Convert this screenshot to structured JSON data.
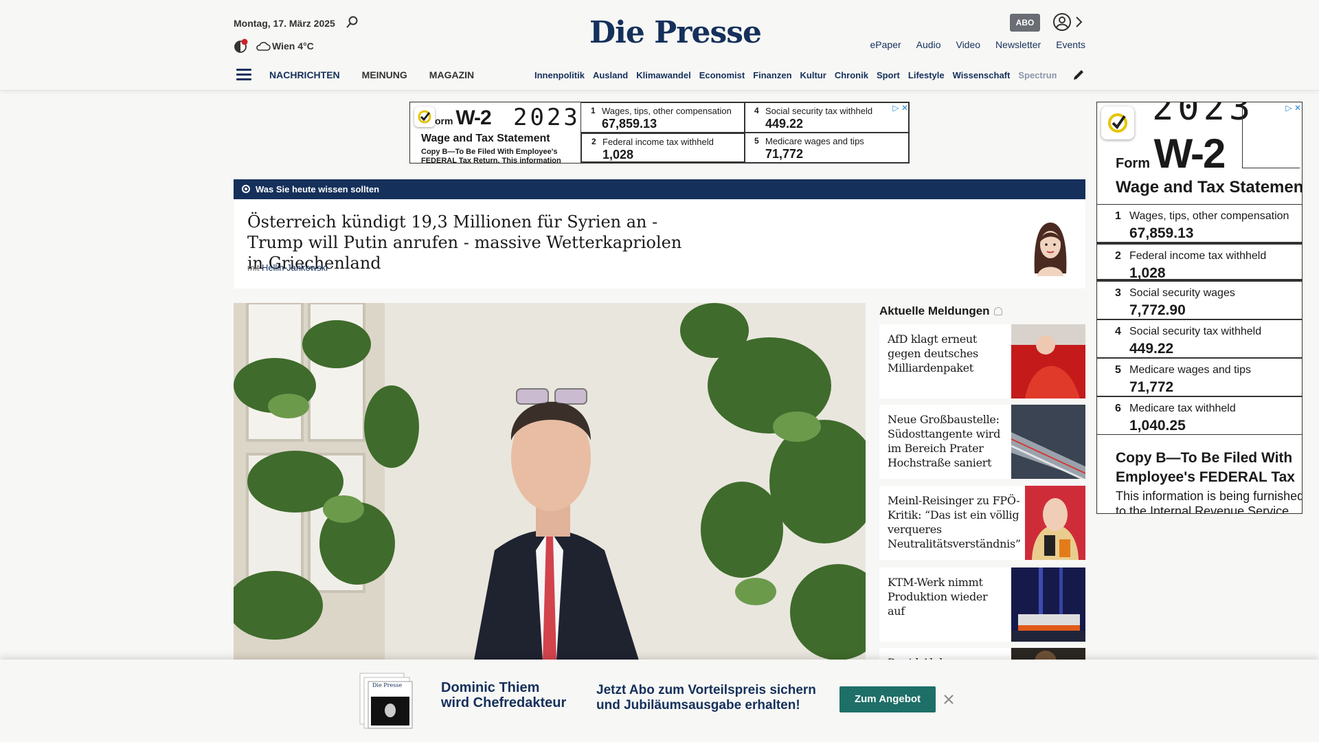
{
  "header": {
    "date": "Montag, 17. März 2025",
    "weather": "Wien 4°C",
    "logo": "Die Presse",
    "abo_label": "ABO",
    "top_links": [
      "ePaper",
      "Audio",
      "Video",
      "Newsletter",
      "Events"
    ],
    "main_nav": [
      "NACHRICHTEN",
      "MEINUNG",
      "MAGAZIN"
    ],
    "sub_nav": [
      "Innenpolitik",
      "Ausland",
      "Klimawandel",
      "Economist",
      "Finanzen",
      "Kultur",
      "Chronik",
      "Sport",
      "Lifestyle",
      "Wissenschaft",
      "Spectrum"
    ],
    "brand_color": "#15305b"
  },
  "ad_banner": {
    "form_prefix": "orm",
    "form_name": "W-2",
    "year": "2023",
    "title": "Wage and Tax Statement",
    "copy_b": "Copy B—To Be Filed With Employee's FEDERAL Tax Return. This information",
    "cells": [
      {
        "num": "1",
        "label": "Wages, tips, other compensation",
        "value": "67,859.13"
      },
      {
        "num": "4",
        "label": "Social security tax withheld",
        "value": "449.22"
      },
      {
        "num": "2",
        "label": "Federal income tax withheld",
        "value": "1,028"
      },
      {
        "num": "5",
        "label": "Medicare wages and tips",
        "value": "71,772"
      }
    ]
  },
  "ad_sky": {
    "year": "2023",
    "form_prefix": "Form",
    "form_name": "W-2",
    "title": "Wage and Tax Statemen",
    "rows": [
      {
        "num": "1",
        "label": "Wages, tips, other compensation",
        "value": "67,859.13"
      },
      {
        "num": "2",
        "label": "Federal income tax withheld",
        "value": "1,028"
      },
      {
        "num": "3",
        "label": "Social security wages",
        "value": "7,772.90"
      },
      {
        "num": "4",
        "label": "Social security tax withheld",
        "value": "449.22"
      },
      {
        "num": "5",
        "label": "Medicare wages and tips",
        "value": "71,772"
      },
      {
        "num": "6",
        "label": "Medicare tax withheld",
        "value": "1,040.25"
      }
    ],
    "copy_b_line1": "Copy B—To Be Filed With",
    "copy_b_line2": "Employee's FEDERAL Tax",
    "info_line1": "This information is being furnished",
    "info_line2": "to the Internal Revenue Service"
  },
  "briefing": {
    "label": "Was Sie heute wissen sollten",
    "headline": "Österreich kündigt 19,3 Millionen für Syrien an - Trump will Putin anrufen - massive Wetterkapriolen in Griechenland",
    "author_prefix": "mit",
    "author": "Hellin Jankowski"
  },
  "news": {
    "title": "Aktuelle Meldungen",
    "items": [
      {
        "text": "AfD klagt erneut gegen deutsches Milliardenpaket",
        "image": "red-robe-judge"
      },
      {
        "text": "Neue Großbaustelle: Südosttangente wird im Bereich Prater Hochstraße saniert",
        "image": "highway-night"
      },
      {
        "text": "Meinl-Reisinger zu FPÖ-Kritik: “Das ist ein völlig verqueres Neutralitätsverständnis”",
        "image": "politician-microphones"
      },
      {
        "text": "KTM-Werk nimmt Produktion wieder auf",
        "image": "factory-night"
      },
      {
        "text": "David Alaba …",
        "image": "dark-photo"
      }
    ]
  },
  "promo": {
    "headline_line1": "Dominic Thiem",
    "headline_line2": "wird Chefredakteur",
    "text_line1": "Jetzt Abo zum Vorteilspreis sichern",
    "text_line2": "und Jubiläumsausgabe erhalten!",
    "button": "Zum Angebot",
    "button_color": "#1e6f68"
  }
}
